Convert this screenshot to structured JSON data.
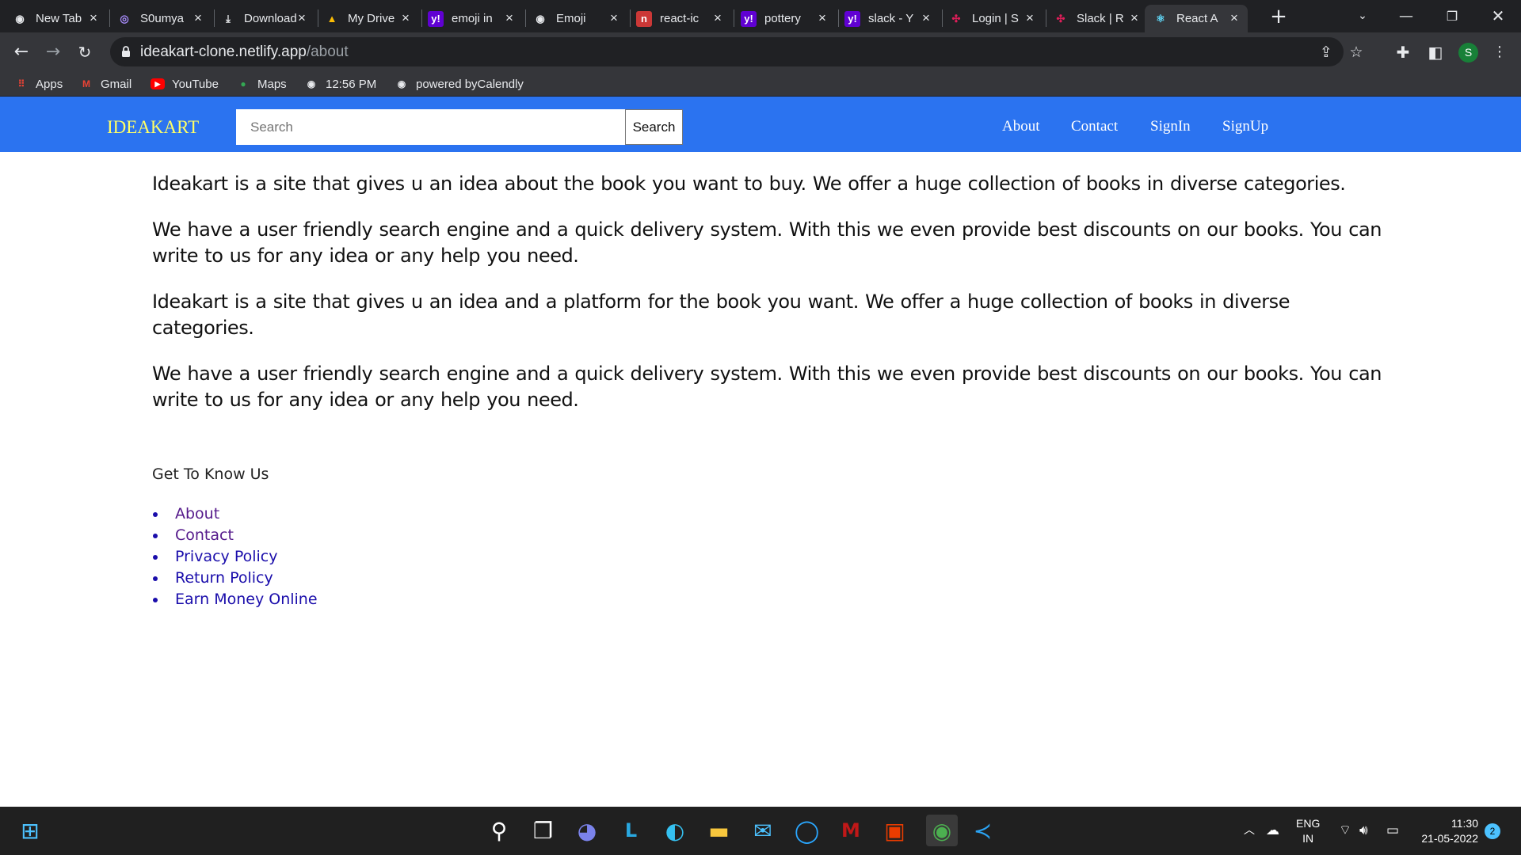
{
  "browser": {
    "tabs": [
      {
        "title": "New Tab",
        "icon": "globe-icon"
      },
      {
        "title": "S0umya",
        "icon": "github-icon"
      },
      {
        "title": "Download",
        "icon": "download-icon"
      },
      {
        "title": "My Drive",
        "icon": "drive-icon"
      },
      {
        "title": "emoji in",
        "icon": "yahoo-icon"
      },
      {
        "title": "Emoji",
        "icon": "globe-icon"
      },
      {
        "title": "react-ic",
        "icon": "npm-icon"
      },
      {
        "title": "pottery",
        "icon": "yahoo-icon"
      },
      {
        "title": "slack - Y",
        "icon": "yahoo-icon"
      },
      {
        "title": "Login | S",
        "icon": "slack-icon"
      },
      {
        "title": "Slack | R",
        "icon": "slack-icon"
      },
      {
        "title": "React A",
        "icon": "react-icon",
        "active": true
      }
    ],
    "url_host": "ideakart-clone.netlify.app",
    "url_path": "/about",
    "profile_initial": "S",
    "bookmarks": [
      {
        "label": "Apps",
        "icon": "apps-grid-icon"
      },
      {
        "label": "Gmail",
        "icon": "gmail-icon"
      },
      {
        "label": "YouTube",
        "icon": "youtube-icon"
      },
      {
        "label": "Maps",
        "icon": "maps-pin-icon"
      },
      {
        "label": "12:56 PM",
        "icon": "globe-icon"
      },
      {
        "label": "powered byCalendly",
        "icon": "globe-icon"
      }
    ]
  },
  "page": {
    "brand": "IDEAKART",
    "search_placeholder": "Search",
    "search_button": "Search",
    "nav_links": [
      "About",
      "Contact",
      "SignIn",
      "SignUp"
    ],
    "paragraphs": [
      "Ideakart is a site that gives u an idea about the book you want to buy. We offer a huge collection of books in diverse categories.",
      "We have a user friendly search engine and a quick delivery system. With this we even provide best discounts on our books. You can write to us for any idea or any help you need.",
      "Ideakart is a site that gives u an idea and a platform for the book you want. We offer a huge collection of books in diverse categories.",
      "We have a user friendly search engine and a quick delivery system. With this we even provide best discounts on our books. You can write to us for any idea or any help you need."
    ],
    "footer_title": "Get To Know Us",
    "footer_links": [
      {
        "label": "About",
        "visited": true
      },
      {
        "label": "Contact",
        "visited": true
      },
      {
        "label": "Privacy Policy",
        "visited": false
      },
      {
        "label": "Return Policy",
        "visited": false
      },
      {
        "label": "Earn Money Online",
        "visited": false
      }
    ]
  },
  "taskbar": {
    "apps": [
      "start-icon",
      "search-icon",
      "task-view-icon",
      "teams-chat-icon",
      "l-app-icon",
      "edge-icon",
      "file-explorer-icon",
      "mail-icon",
      "cortana-icon",
      "mcafee-icon",
      "office-icon",
      "chrome-icon",
      "vscode-icon"
    ],
    "lang_line1": "ENG",
    "lang_line2": "IN",
    "time": "11:30",
    "date": "21-05-2022",
    "notifications": "2"
  },
  "colors": {
    "navbar": "#2b73f0",
    "brand": "#ffff66",
    "visited_link": "#551a8b",
    "link": "#1a0dab",
    "chrome_dark": "#202124",
    "chrome_toolbar": "#35363a"
  }
}
